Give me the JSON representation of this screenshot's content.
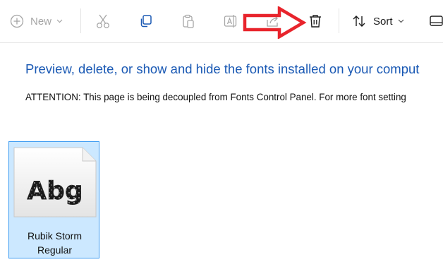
{
  "toolbar": {
    "new_label": "New",
    "sort_label": "Sort",
    "icons": [
      "plus-circle-icon",
      "chevron-down-icon",
      "cut-icon",
      "copy-icon",
      "paste-icon",
      "rename-icon",
      "share-icon",
      "delete-icon",
      "sort-icon",
      "view-icon"
    ]
  },
  "annotation": {
    "arrow_color": "#e8242c",
    "arrow_target": "delete-icon"
  },
  "main": {
    "title": "Preview, delete, or show and hide the fonts installed on your comput",
    "note": "ATTENTION: This page is being decoupled from Fonts Control Panel. For more font setting"
  },
  "font_tile": {
    "preview_text": "Abg",
    "name_line1": "Rubik Storm",
    "name_line2": "Regular",
    "selected": true
  },
  "colors": {
    "title": "#1a59b4",
    "selection_fill": "#cce8ff",
    "selection_border": "#3d9bf1",
    "accent_icon": "#1a59b4"
  }
}
